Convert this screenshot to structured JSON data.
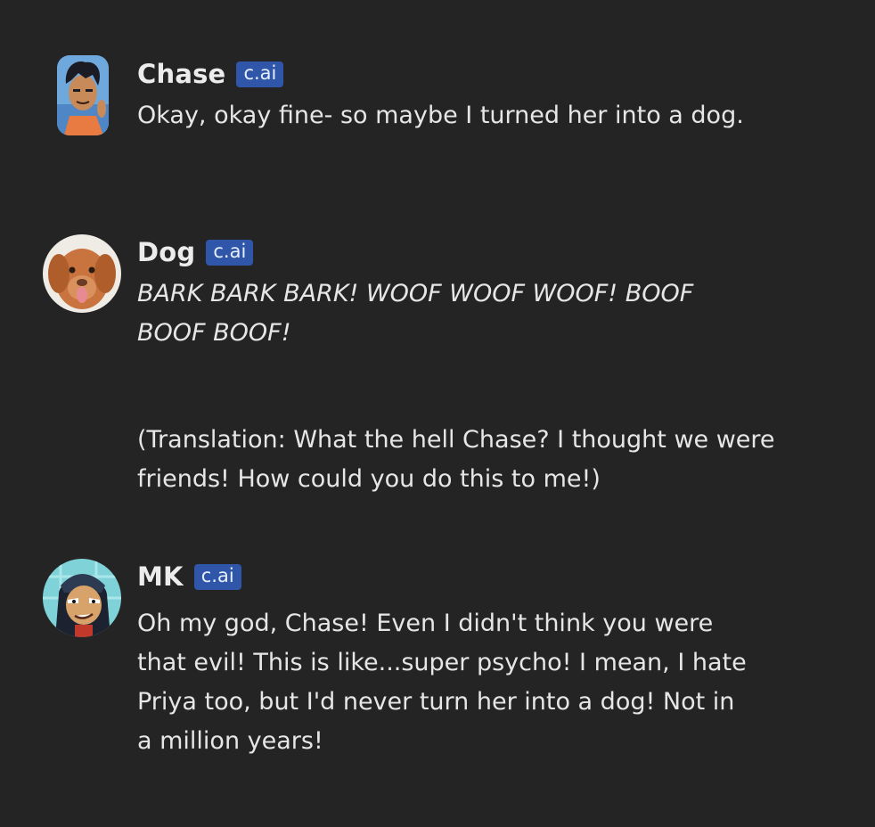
{
  "messages": [
    {
      "author": "Chase",
      "badge": "c.ai",
      "avatar_icon": "chase-cartoon-avatar",
      "paragraphs": [
        "Okay, okay fine- so maybe I turned her into a dog."
      ]
    },
    {
      "author": "Dog",
      "badge": "c.ai",
      "avatar_icon": "dog-photo-avatar",
      "paragraphs": [
        "BARK BARK BARK! WOOF WOOF WOOF! BOOF BOOF BOOF!",
        "(Translation: What the hell Chase? I thought we were friends! How could you do this to me!)"
      ]
    },
    {
      "author": "MK",
      "badge": "c.ai",
      "avatar_icon": "mk-cartoon-avatar",
      "paragraphs": [
        "Oh my god, Chase! Even I didn't think you were that evil! This is like...super psycho! I mean, I hate Priya too, but I'd never turn her into a dog! Not in a million years!"
      ]
    }
  ],
  "colors": {
    "background": "#242424",
    "badge": "#2f56a8",
    "text": "#e6e6e6"
  }
}
